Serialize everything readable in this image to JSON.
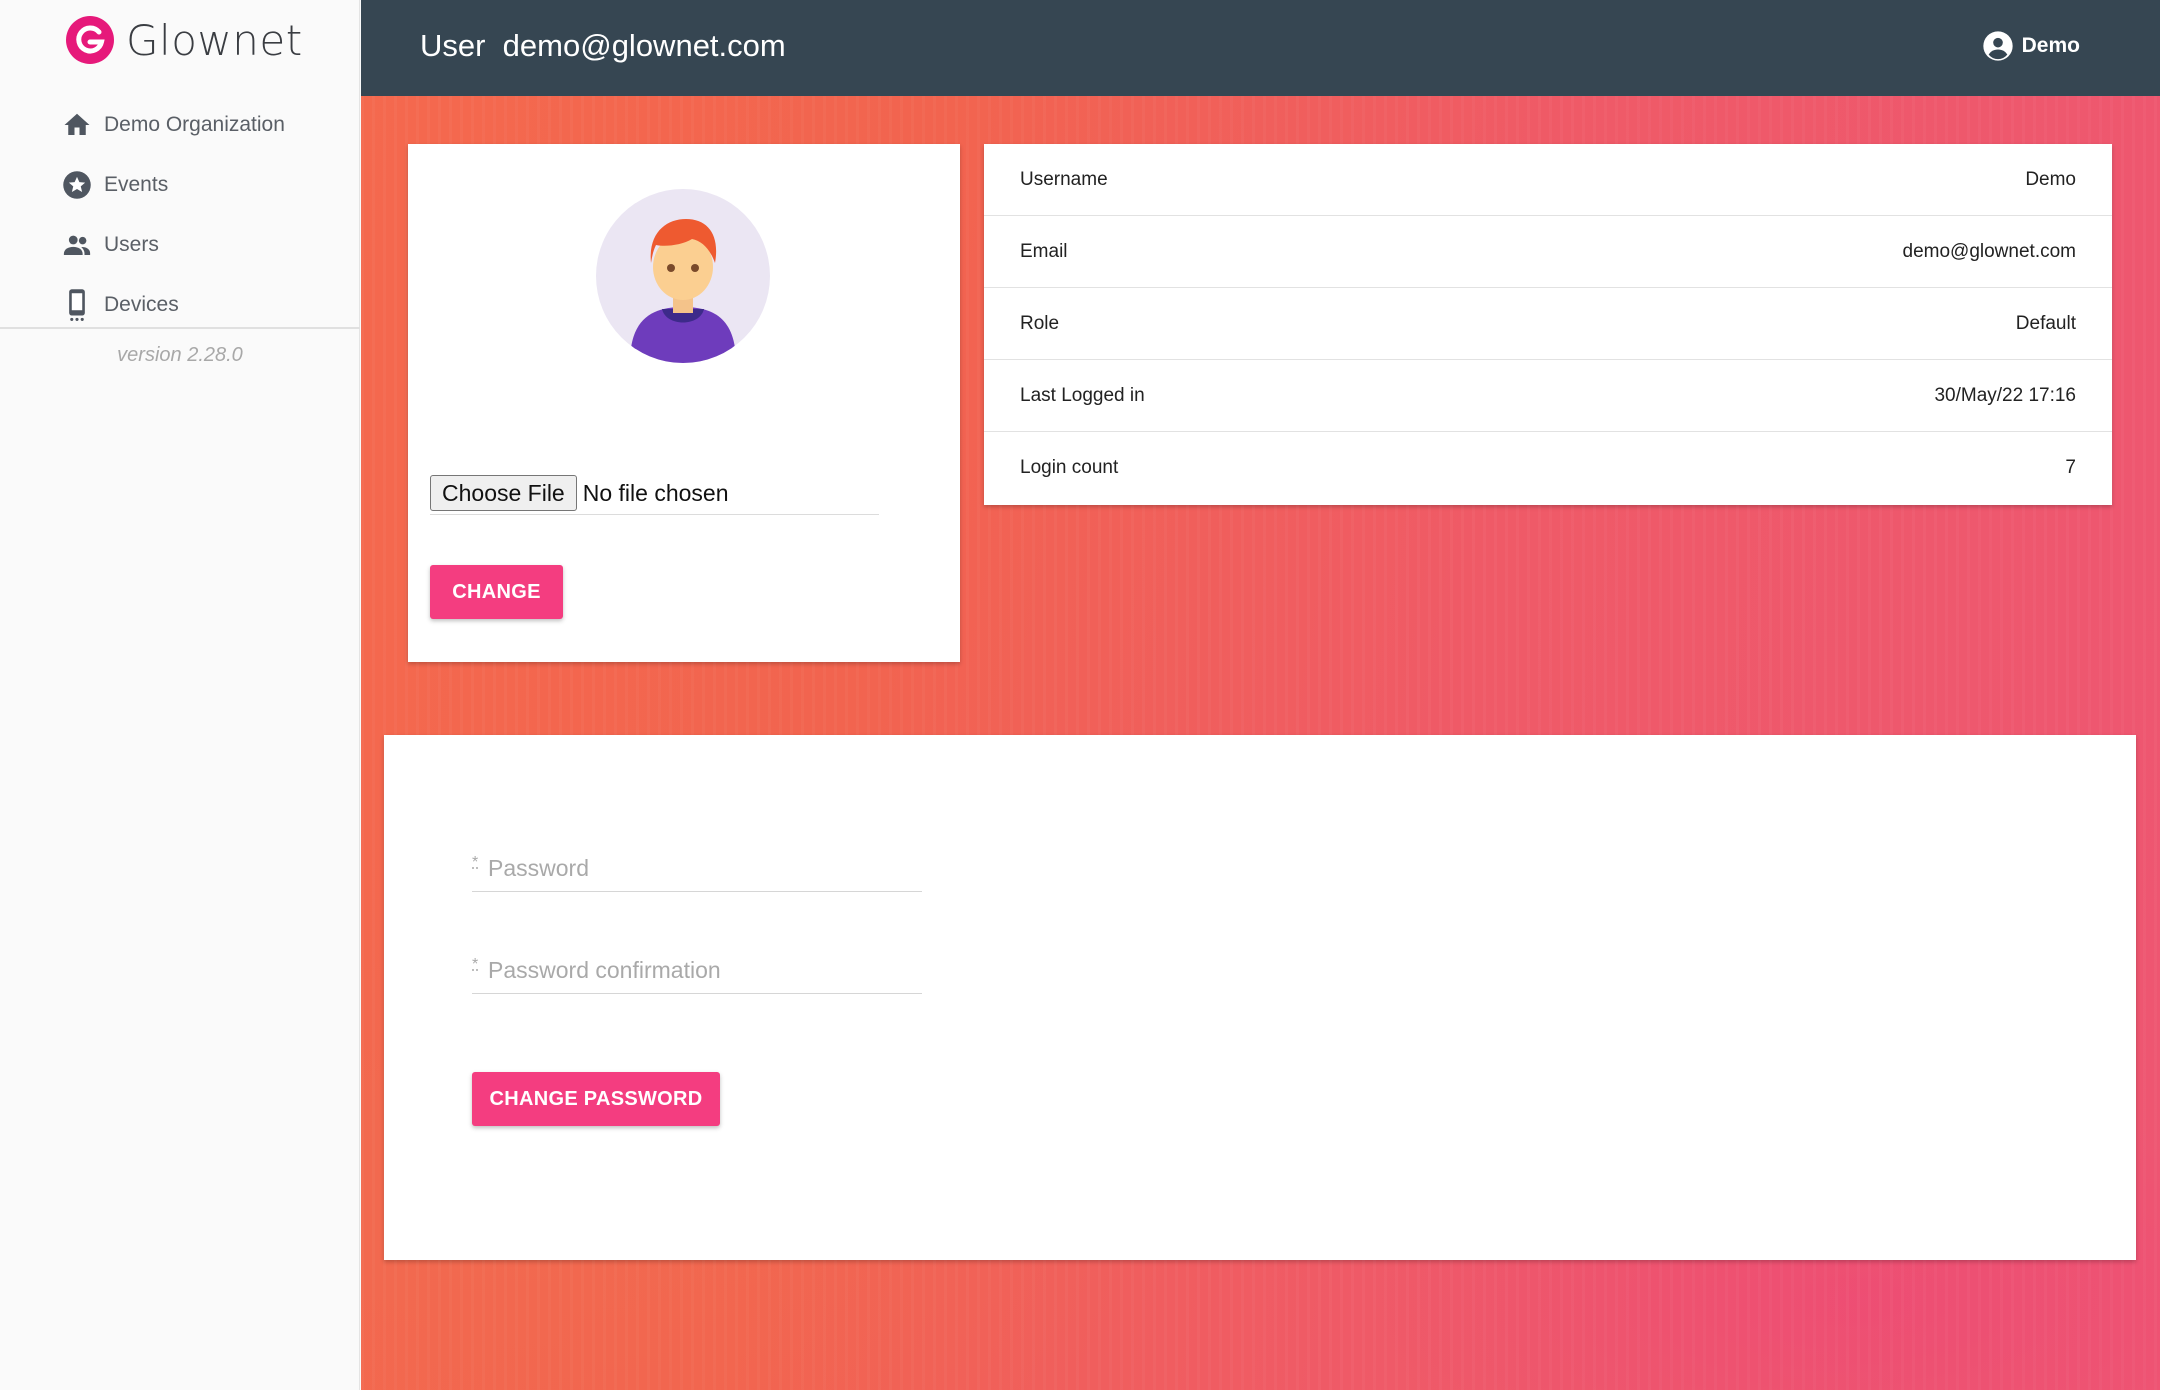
{
  "brand": {
    "name": "Glownet",
    "logo_color": "#e6197a"
  },
  "sidebar": {
    "items": [
      {
        "label": "Demo Organization",
        "icon": "home-icon"
      },
      {
        "label": "Events",
        "icon": "star-circle-icon"
      },
      {
        "label": "Users",
        "icon": "users-icon"
      },
      {
        "label": "Devices",
        "icon": "phone-device-icon"
      }
    ],
    "version": "version 2.28.0"
  },
  "header": {
    "title": "User  demo@glownet.com",
    "user_label": "Demo",
    "background": "#364652"
  },
  "avatar_card": {
    "file_button": "Choose File",
    "file_status": "No file chosen",
    "change_label": "CHANGE"
  },
  "info": {
    "rows": [
      {
        "label": "Username",
        "value": "Demo"
      },
      {
        "label": "Email",
        "value": "demo@glownet.com"
      },
      {
        "label": "Role",
        "value": "Default"
      },
      {
        "label": "Last Logged in",
        "value": "30/May/22 17:16"
      },
      {
        "label": "Login count",
        "value": "7"
      }
    ]
  },
  "password_form": {
    "password_placeholder": "Password",
    "password_confirmation_placeholder": "Password confirmation",
    "required_mark": "*",
    "submit_label": "CHANGE PASSWORD"
  },
  "colors": {
    "accent": "#f43d80",
    "topbar": "#364652"
  }
}
